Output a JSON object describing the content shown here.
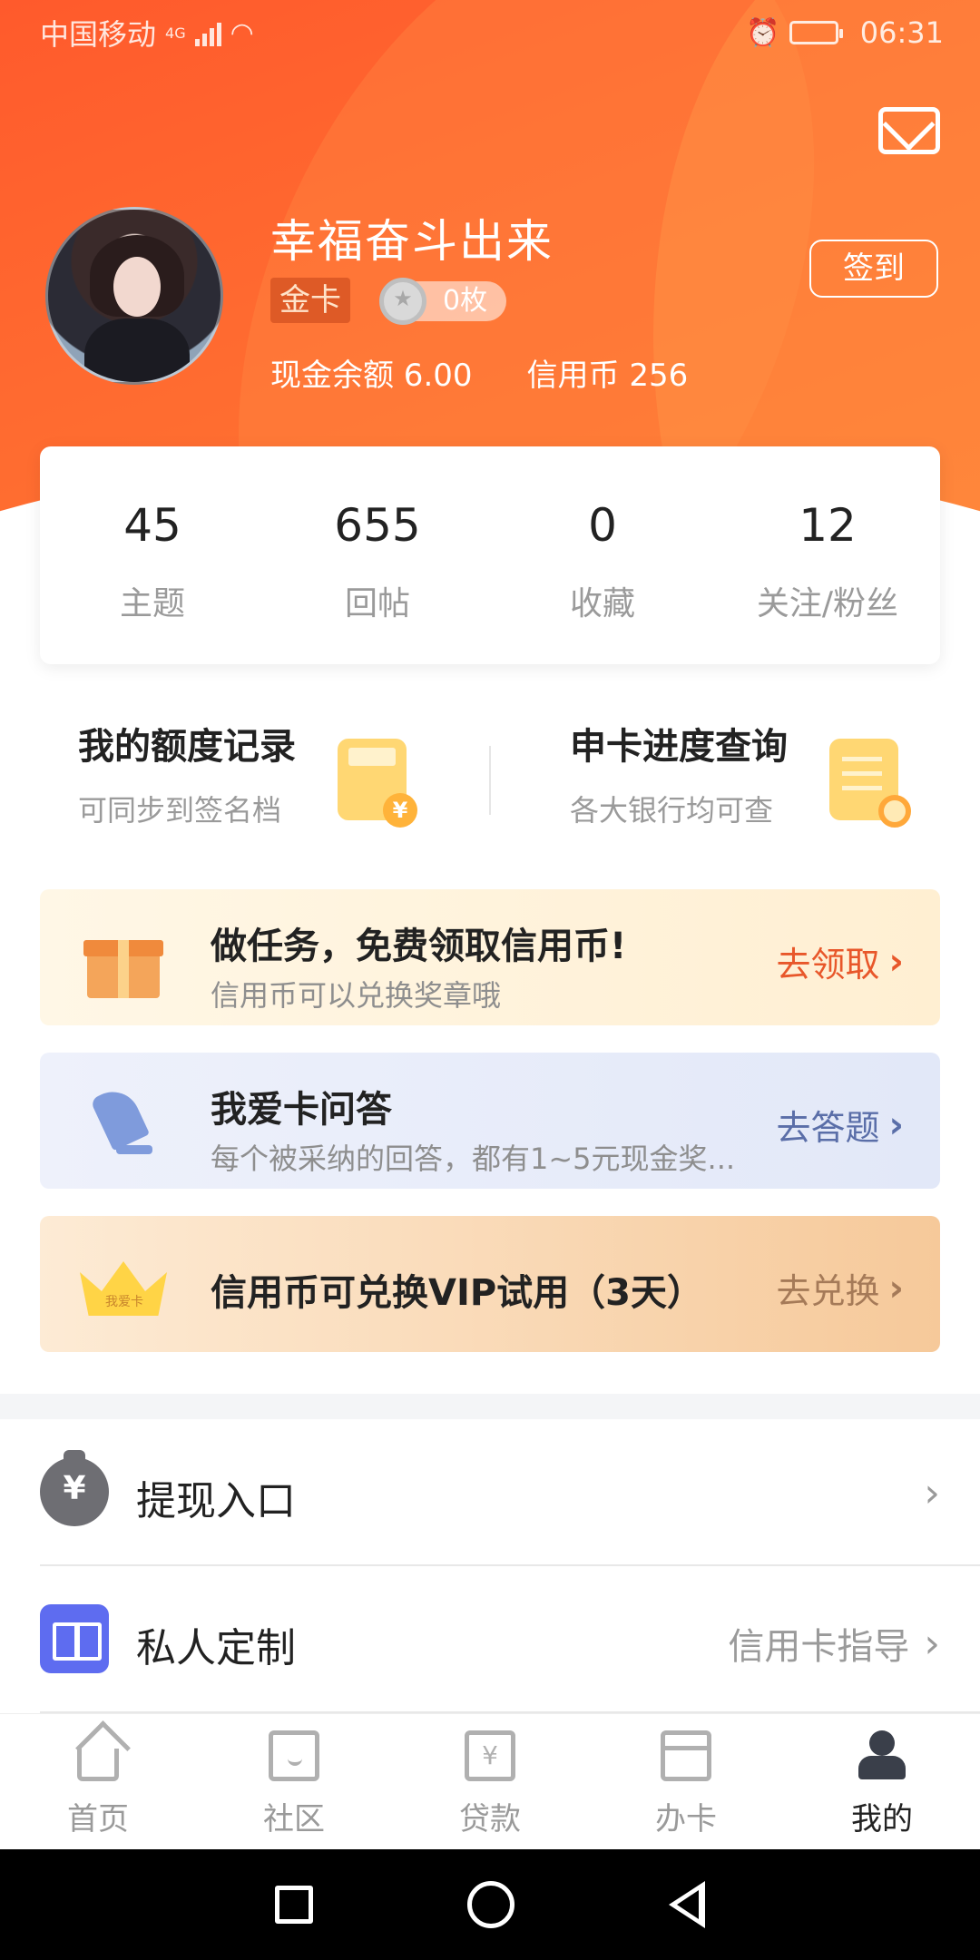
{
  "status_bar": {
    "carrier": "中国移动",
    "network": "4G",
    "time": "06:31"
  },
  "profile": {
    "username": "幸福奋斗出来",
    "level": "金卡",
    "medals": "0枚",
    "cash_balance": "现金余额 6.00",
    "credit_coins": "信用币 256",
    "checkin_label": "签到"
  },
  "stats": [
    {
      "value": "45",
      "label": "主题"
    },
    {
      "value": "655",
      "label": "回帖"
    },
    {
      "value": "0",
      "label": "收藏"
    },
    {
      "value": "12",
      "label": "关注/粉丝"
    }
  ],
  "tools": {
    "quota": {
      "title": "我的额度记录",
      "subtitle": "可同步到签名档"
    },
    "progress": {
      "title": "申卡进度查询",
      "subtitle": "各大银行均可查"
    }
  },
  "banners": {
    "task": {
      "title": "做任务，免费领取信用币!",
      "subtitle": "信用币可以兑换奖章哦",
      "action": "去领取",
      "action_color": "#e8572a"
    },
    "qa": {
      "title": "我爱卡问答",
      "subtitle": "每个被采纳的回答，都有1~5元现金奖...",
      "action": "去答题",
      "action_color": "#5a6ea8"
    },
    "vip": {
      "title": "信用币可兑换VIP试用（3天）",
      "action": "去兑换",
      "action_color": "#a57a58",
      "crown_text": "我爱卡"
    }
  },
  "menu": {
    "withdraw": {
      "label": "提现入口"
    },
    "custom": {
      "label": "私人定制",
      "value": "信用卡指导"
    }
  },
  "bottom_nav": [
    {
      "label": "首页"
    },
    {
      "label": "社区"
    },
    {
      "label": "贷款"
    },
    {
      "label": "办卡"
    },
    {
      "label": "我的"
    }
  ],
  "colors": {
    "brand": "#ff5a2c",
    "icon_blue": "#5e6cf0"
  }
}
